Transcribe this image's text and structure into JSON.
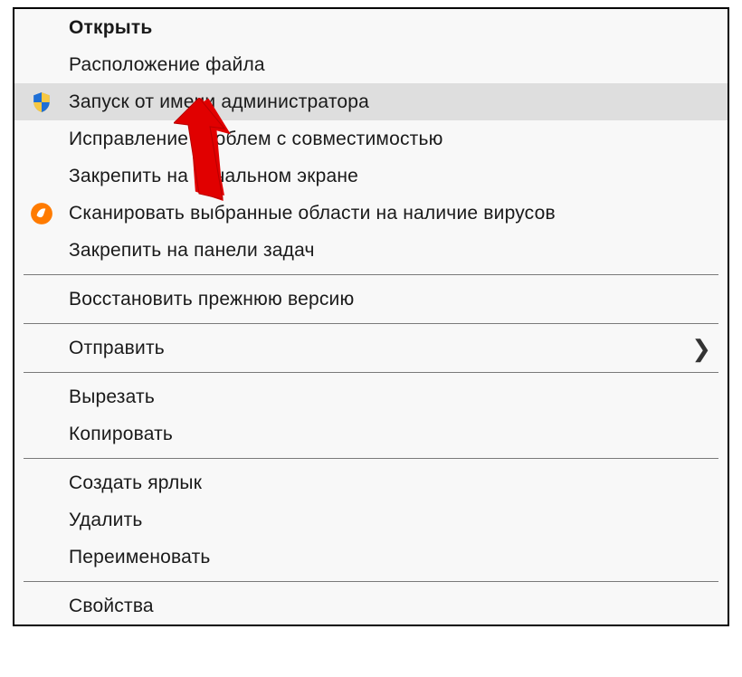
{
  "menu": {
    "sections": [
      [
        {
          "id": "open",
          "label": "Открыть",
          "bold": true
        },
        {
          "id": "file-location",
          "label": "Расположение файла"
        },
        {
          "id": "run-as-admin",
          "label": "Запуск от имени администратора",
          "highlighted": true,
          "icon": "shield"
        },
        {
          "id": "compat-troubleshoot",
          "label": "Исправление проблем с совместимостью"
        },
        {
          "id": "pin-start",
          "label": "Закрепить на начальном экране"
        },
        {
          "id": "scan-virus",
          "label": "Сканировать выбранные области на наличие вирусов",
          "icon": "avast"
        },
        {
          "id": "pin-taskbar",
          "label": "Закрепить на панели задач"
        }
      ],
      [
        {
          "id": "restore-previous",
          "label": "Восстановить прежнюю версию"
        }
      ],
      [
        {
          "id": "send-to",
          "label": "Отправить",
          "submenu": true
        }
      ],
      [
        {
          "id": "cut",
          "label": "Вырезать"
        },
        {
          "id": "copy",
          "label": "Копировать"
        }
      ],
      [
        {
          "id": "create-shortcut",
          "label": "Создать ярлык"
        },
        {
          "id": "delete",
          "label": "Удалить"
        },
        {
          "id": "rename",
          "label": "Переименовать"
        }
      ],
      [
        {
          "id": "properties",
          "label": "Свойства"
        }
      ]
    ]
  },
  "annotation": {
    "arrow_color": "#e10000"
  }
}
